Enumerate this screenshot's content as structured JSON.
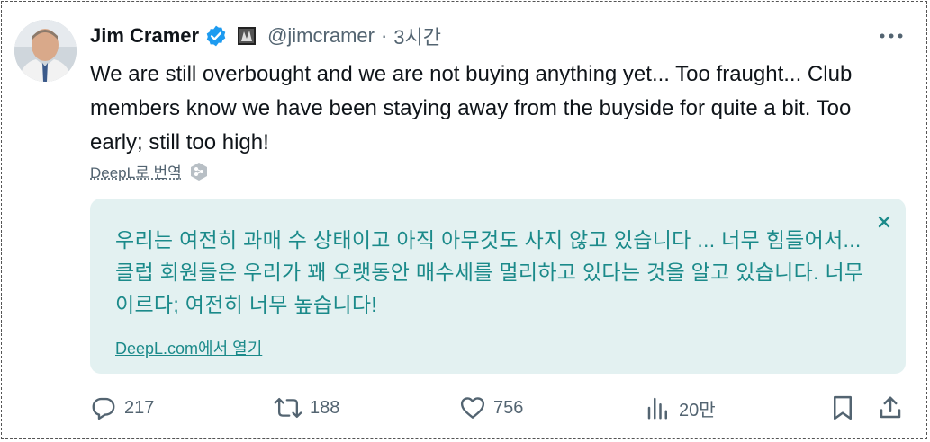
{
  "author": {
    "name": "Jim Cramer",
    "handle": "@jimcramer",
    "time": "3시간",
    "separator": "·"
  },
  "tweet": {
    "text": "We are still overbought and we are not buying anything yet... Too fraught... Club members know we have been staying away from the buyside for quite a bit. Too early; still too high!"
  },
  "translate": {
    "link_label": "DeepL로 번역",
    "translated_text": "우리는 여전히 과매 수 상태이고 아직 아무것도 사지 않고 있습니다 ... 너무 힘들어서... 클럽 회원들은 우리가 꽤 오랫동안 매수세를 멀리하고 있다는 것을 알고 있습니다. 너무 이르다; 여전히 너무 높습니다!",
    "open_label": "DeepL.com에서 열기",
    "close_symbol": "×"
  },
  "actions": {
    "replies": "217",
    "reposts": "188",
    "likes": "756",
    "views": "20만"
  },
  "colors": {
    "verified": "#1d9bf0",
    "muted": "#536471",
    "teal": "#1b8a8a",
    "translation_bg": "#e3f1f1"
  },
  "icons": [
    "verified-badge-icon",
    "affiliate-badge-icon",
    "more-icon",
    "deepl-icon",
    "close-icon",
    "reply-icon",
    "repost-icon",
    "like-icon",
    "views-icon",
    "bookmark-icon",
    "share-icon"
  ]
}
